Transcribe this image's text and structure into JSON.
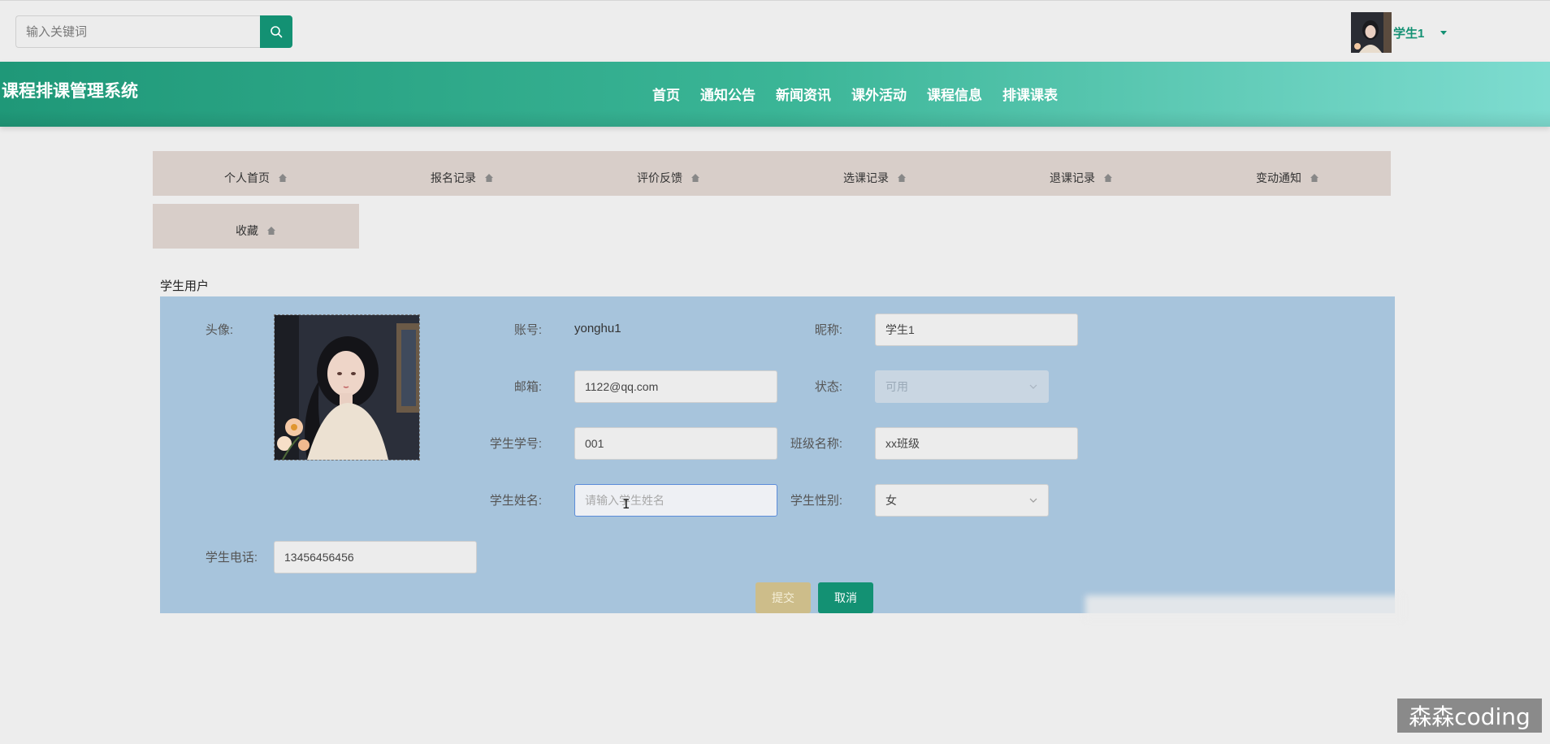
{
  "search": {
    "placeholder": "输入关键词"
  },
  "user": {
    "name": "学生1"
  },
  "header": {
    "title": "课程排课管理系统",
    "nav": [
      "首页",
      "通知公告",
      "新闻资讯",
      "课外活动",
      "课程信息",
      "排课课表"
    ]
  },
  "submenu": {
    "items": [
      "个人首页",
      "报名记录",
      "评价反馈",
      "选课记录",
      "退课记录",
      "变动通知",
      "收藏"
    ]
  },
  "section_title": "学生用户",
  "form": {
    "avatar_label": "头像:",
    "account_label": "账号:",
    "account_value": "yonghu1",
    "nickname_label": "昵称:",
    "nickname_value": "学生1",
    "email_label": "邮箱:",
    "email_value": "1122@qq.com",
    "status_label": "状态:",
    "status_value": "可用",
    "student_no_label": "学生学号:",
    "student_no_value": "001",
    "class_label": "班级名称:",
    "class_value": "xx班级",
    "student_name_label": "学生姓名:",
    "student_name_placeholder": "请输入学生姓名",
    "gender_label": "学生性别:",
    "gender_value": "女",
    "phone_label": "学生电话:",
    "phone_value": "13456456456",
    "submit_label": "提交",
    "cancel_label": "取消"
  },
  "watermark": "森森coding",
  "colors": {
    "accent": "#139173",
    "submit": "#cdbd8a",
    "panel": "#a7c4dc",
    "submenu": "#d8cec9"
  }
}
